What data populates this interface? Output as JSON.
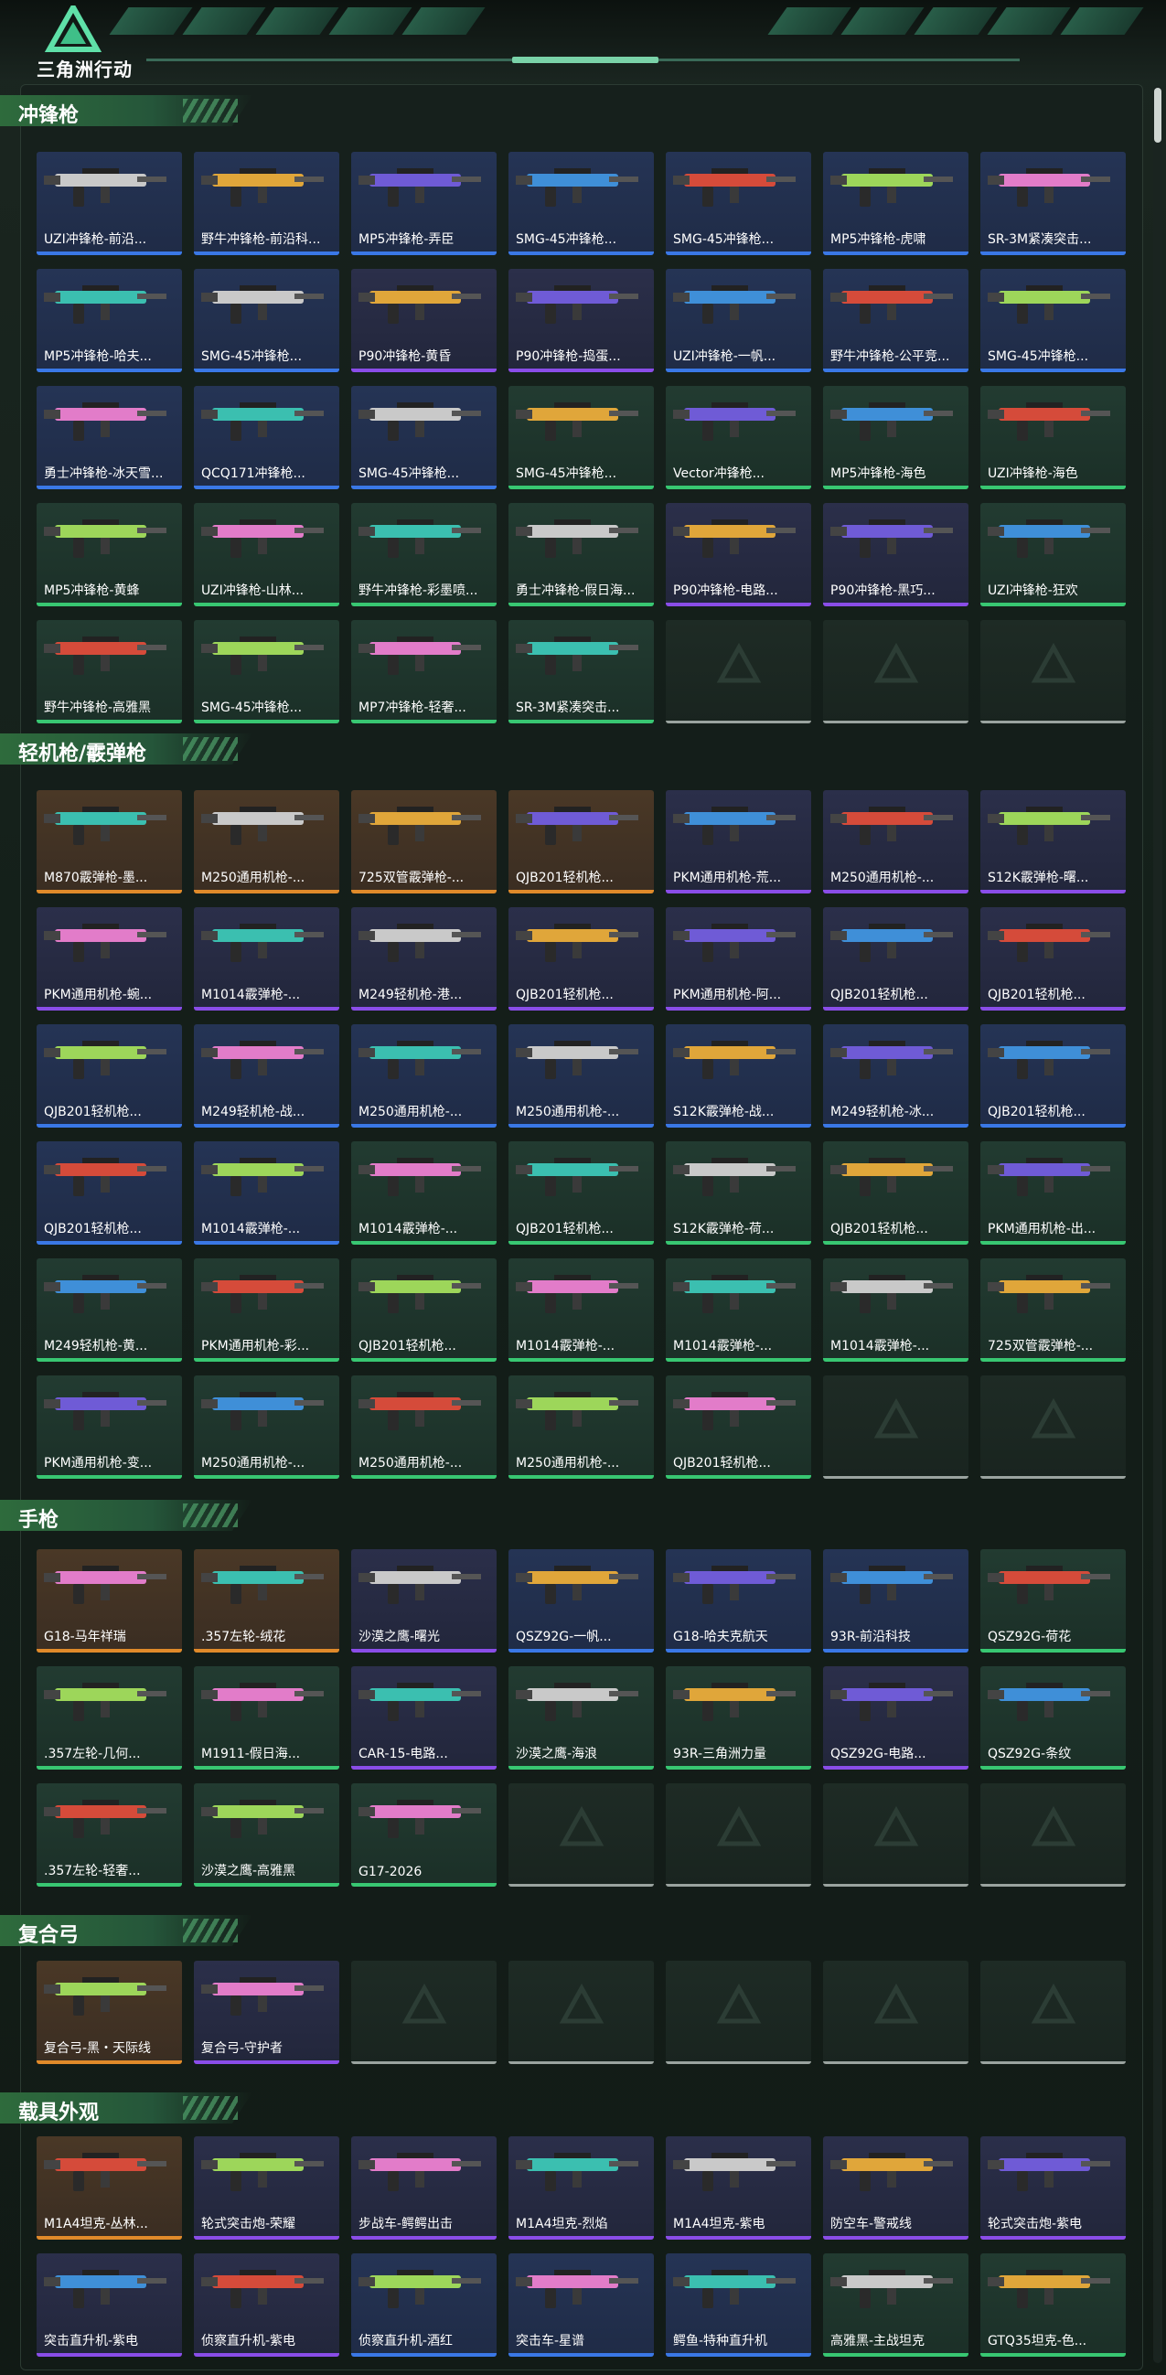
{
  "header": {
    "logo_text": "三角洲行动"
  },
  "sections": [
    {
      "title": "冲锋枪",
      "items": [
        {
          "label": "UZI冲锋枪-前沿...",
          "rarity": "blue"
        },
        {
          "label": "野牛冲锋枪-前沿科...",
          "rarity": "blue"
        },
        {
          "label": "MP5冲锋枪-弄臣",
          "rarity": "blue"
        },
        {
          "label": "SMG-45冲锋枪...",
          "rarity": "blue"
        },
        {
          "label": "SMG-45冲锋枪...",
          "rarity": "blue"
        },
        {
          "label": "MP5冲锋枪-虎啸",
          "rarity": "blue"
        },
        {
          "label": "SR-3M紧凑突击...",
          "rarity": "blue"
        },
        {
          "label": "MP5冲锋枪-哈夫...",
          "rarity": "blue"
        },
        {
          "label": "SMG-45冲锋枪...",
          "rarity": "blue"
        },
        {
          "label": "P90冲锋枪-黄昏",
          "rarity": "purple"
        },
        {
          "label": "P90冲锋枪-捣蛋...",
          "rarity": "purple"
        },
        {
          "label": "UZI冲锋枪-一帆...",
          "rarity": "blue"
        },
        {
          "label": "野牛冲锋枪-公平竞...",
          "rarity": "blue"
        },
        {
          "label": "SMG-45冲锋枪...",
          "rarity": "blue"
        },
        {
          "label": "勇士冲锋枪-冰天雪...",
          "rarity": "blue"
        },
        {
          "label": "QCQ171冲锋枪...",
          "rarity": "blue"
        },
        {
          "label": "SMG-45冲锋枪...",
          "rarity": "blue"
        },
        {
          "label": "SMG-45冲锋枪...",
          "rarity": "green"
        },
        {
          "label": "Vector冲锋枪...",
          "rarity": "green"
        },
        {
          "label": "MP5冲锋枪-海色",
          "rarity": "green"
        },
        {
          "label": "UZI冲锋枪-海色",
          "rarity": "green"
        },
        {
          "label": "MP5冲锋枪-黄蜂",
          "rarity": "green"
        },
        {
          "label": "UZI冲锋枪-山林...",
          "rarity": "green"
        },
        {
          "label": "野牛冲锋枪-彩墨喷...",
          "rarity": "green"
        },
        {
          "label": "勇士冲锋枪-假日海...",
          "rarity": "green"
        },
        {
          "label": "P90冲锋枪-电路...",
          "rarity": "purple"
        },
        {
          "label": "P90冲锋枪-黑巧...",
          "rarity": "purple"
        },
        {
          "label": "UZI冲锋枪-狂欢",
          "rarity": "green"
        },
        {
          "label": "野牛冲锋枪-高雅黑",
          "rarity": "green"
        },
        {
          "label": "SMG-45冲锋枪...",
          "rarity": "green"
        },
        {
          "label": "MP7冲锋枪-轻奢...",
          "rarity": "green"
        },
        {
          "label": "SR-3M紧凑突击...",
          "rarity": "green"
        },
        {
          "label": "",
          "rarity": "empty"
        },
        {
          "label": "",
          "rarity": "empty"
        },
        {
          "label": "",
          "rarity": "empty"
        }
      ]
    },
    {
      "title": "轻机枪/霰弹枪",
      "items": [
        {
          "label": "M870霰弹枪-墨...",
          "rarity": "gold"
        },
        {
          "label": "M250通用机枪-...",
          "rarity": "gold"
        },
        {
          "label": "725双管霰弹枪-...",
          "rarity": "gold"
        },
        {
          "label": "QJB201轻机枪...",
          "rarity": "gold"
        },
        {
          "label": "PKM通用机枪-荒...",
          "rarity": "purple"
        },
        {
          "label": "M250通用机枪-...",
          "rarity": "purple"
        },
        {
          "label": "S12K霰弹枪-曙...",
          "rarity": "purple"
        },
        {
          "label": "PKM通用机枪-蜿...",
          "rarity": "purple"
        },
        {
          "label": "M1014霰弹枪-...",
          "rarity": "purple"
        },
        {
          "label": "M249轻机枪-港...",
          "rarity": "purple"
        },
        {
          "label": "QJB201轻机枪...",
          "rarity": "purple"
        },
        {
          "label": "PKM通用机枪-阿...",
          "rarity": "purple"
        },
        {
          "label": "QJB201轻机枪...",
          "rarity": "purple"
        },
        {
          "label": "QJB201轻机枪...",
          "rarity": "purple"
        },
        {
          "label": "QJB201轻机枪...",
          "rarity": "blue"
        },
        {
          "label": "M249轻机枪-战...",
          "rarity": "blue"
        },
        {
          "label": "M250通用机枪-...",
          "rarity": "blue"
        },
        {
          "label": "M250通用机枪-...",
          "rarity": "blue"
        },
        {
          "label": "S12K霰弹枪-战...",
          "rarity": "blue"
        },
        {
          "label": "M249轻机枪-冰...",
          "rarity": "blue"
        },
        {
          "label": "QJB201轻机枪...",
          "rarity": "blue"
        },
        {
          "label": "QJB201轻机枪...",
          "rarity": "blue"
        },
        {
          "label": "M1014霰弹枪-...",
          "rarity": "blue"
        },
        {
          "label": "M1014霰弹枪-...",
          "rarity": "green"
        },
        {
          "label": "QJB201轻机枪...",
          "rarity": "green"
        },
        {
          "label": "S12K霰弹枪-荷...",
          "rarity": "green"
        },
        {
          "label": "QJB201轻机枪...",
          "rarity": "green"
        },
        {
          "label": "PKM通用机枪-出...",
          "rarity": "green"
        },
        {
          "label": "M249轻机枪-黄...",
          "rarity": "green"
        },
        {
          "label": "PKM通用机枪-彩...",
          "rarity": "green"
        },
        {
          "label": "QJB201轻机枪...",
          "rarity": "green"
        },
        {
          "label": "M1014霰弹枪-...",
          "rarity": "green"
        },
        {
          "label": "M1014霰弹枪-...",
          "rarity": "green"
        },
        {
          "label": "M1014霰弹枪-...",
          "rarity": "green"
        },
        {
          "label": "725双管霰弹枪-...",
          "rarity": "green"
        },
        {
          "label": "PKM通用机枪-变...",
          "rarity": "green"
        },
        {
          "label": "M250通用机枪-...",
          "rarity": "green"
        },
        {
          "label": "M250通用机枪-...",
          "rarity": "green"
        },
        {
          "label": "M250通用机枪-...",
          "rarity": "green"
        },
        {
          "label": "QJB201轻机枪...",
          "rarity": "green"
        },
        {
          "label": "",
          "rarity": "empty"
        },
        {
          "label": "",
          "rarity": "empty"
        }
      ]
    },
    {
      "title": "手枪",
      "items": [
        {
          "label": "G18-马年祥瑞",
          "rarity": "gold"
        },
        {
          "label": ".357左轮-绒花",
          "rarity": "gold"
        },
        {
          "label": "沙漠之鹰-曙光",
          "rarity": "purple"
        },
        {
          "label": "QSZ92G-一帆...",
          "rarity": "blue"
        },
        {
          "label": "G18-哈夫克航天",
          "rarity": "blue"
        },
        {
          "label": "93R-前沿科技",
          "rarity": "blue"
        },
        {
          "label": "QSZ92G-荷花",
          "rarity": "green"
        },
        {
          "label": ".357左轮-几何...",
          "rarity": "green"
        },
        {
          "label": "M1911-假日海...",
          "rarity": "green"
        },
        {
          "label": "CAR-15-电路...",
          "rarity": "purple"
        },
        {
          "label": "沙漠之鹰-海浪",
          "rarity": "green"
        },
        {
          "label": "93R-三角洲力量",
          "rarity": "green"
        },
        {
          "label": "QSZ92G-电路...",
          "rarity": "purple"
        },
        {
          "label": "QSZ92G-条纹",
          "rarity": "green"
        },
        {
          "label": ".357左轮-轻奢...",
          "rarity": "green"
        },
        {
          "label": "沙漠之鹰-高雅黑",
          "rarity": "green"
        },
        {
          "label": "G17-2026",
          "rarity": "green"
        },
        {
          "label": "",
          "rarity": "empty"
        },
        {
          "label": "",
          "rarity": "empty"
        },
        {
          "label": "",
          "rarity": "empty"
        },
        {
          "label": "",
          "rarity": "empty"
        }
      ]
    },
    {
      "title": "复合弓",
      "items": [
        {
          "label": "复合弓-黑・天际线",
          "rarity": "gold"
        },
        {
          "label": "复合弓-守护者",
          "rarity": "purple"
        },
        {
          "label": "",
          "rarity": "empty"
        },
        {
          "label": "",
          "rarity": "empty"
        },
        {
          "label": "",
          "rarity": "empty"
        },
        {
          "label": "",
          "rarity": "empty"
        },
        {
          "label": "",
          "rarity": "empty"
        }
      ]
    },
    {
      "title": "载具外观",
      "items": [
        {
          "label": "M1A4坦克-丛林...",
          "rarity": "gold"
        },
        {
          "label": "轮式突击炮-荣耀",
          "rarity": "purple"
        },
        {
          "label": "步战车-鳄鳄出击",
          "rarity": "purple"
        },
        {
          "label": "M1A4坦克-烈焰",
          "rarity": "purple"
        },
        {
          "label": "M1A4坦克-紫电",
          "rarity": "purple"
        },
        {
          "label": "防空车-警戒线",
          "rarity": "purple"
        },
        {
          "label": "轮式突击炮-紫电",
          "rarity": "purple"
        },
        {
          "label": "突击直升机-紫电",
          "rarity": "purple"
        },
        {
          "label": "侦察直升机-紫电",
          "rarity": "purple"
        },
        {
          "label": "侦察直升机-酒红",
          "rarity": "blue"
        },
        {
          "label": "突击车-星谱",
          "rarity": "blue"
        },
        {
          "label": "鳄鱼-特种直升机",
          "rarity": "blue"
        },
        {
          "label": "高雅黑-主战坦克",
          "rarity": "green"
        },
        {
          "label": "GTQ35坦克-色...",
          "rarity": "green"
        }
      ]
    }
  ]
}
